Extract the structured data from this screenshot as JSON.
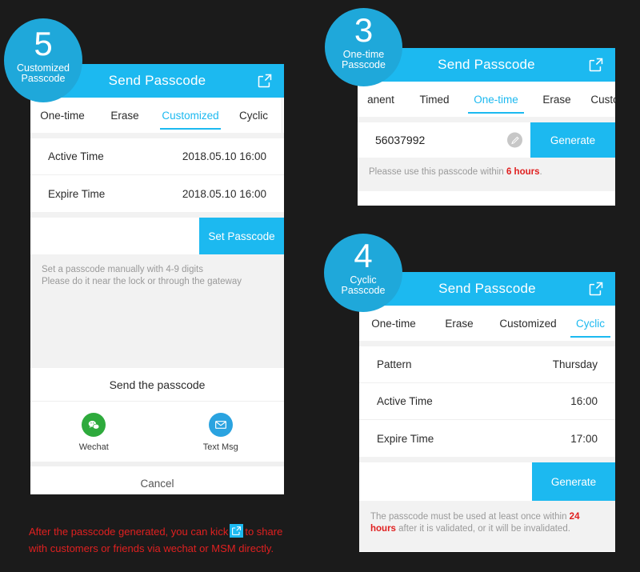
{
  "theme": {
    "background": "#1b1b1b",
    "accent": "#1cb9f0",
    "badge": "#1fa8da",
    "alert_red": "#e02020",
    "wechat_green": "#2eaa3c",
    "sms_blue": "#2aa3e0"
  },
  "panel_customized": {
    "badge": {
      "number": "5",
      "line1": "Customized",
      "line2": "Passcode"
    },
    "header": {
      "title": "Send Passcode",
      "share_icon": "share-external-icon"
    },
    "tabs": [
      {
        "label": "One-time",
        "active": false
      },
      {
        "label": "Erase",
        "active": false
      },
      {
        "label": "Customized",
        "active": true
      },
      {
        "label": "Cyclic",
        "active": false
      }
    ],
    "rows": [
      {
        "label": "Active Time",
        "value": "2018.05.10 16:00"
      },
      {
        "label": "Expire Time",
        "value": "2018.05.10 16:00"
      }
    ],
    "action_button": "Set Passcode",
    "hint_line1": "Set a passcode manually with 4-9 digits",
    "hint_line2": "Please do it near the lock or through the gateway",
    "share_sheet": {
      "title": "Send the passcode",
      "targets": [
        {
          "name": "Wechat",
          "icon": "wechat-icon"
        },
        {
          "name": "Text Msg",
          "icon": "envelope-icon"
        }
      ],
      "cancel": "Cancel"
    }
  },
  "panel_onetime": {
    "badge": {
      "number": "3",
      "line1": "One-time",
      "line2": "Passcode"
    },
    "header": {
      "title": "Send Passcode",
      "share_icon": "share-external-icon"
    },
    "tabs": [
      {
        "label": "anent",
        "active": false
      },
      {
        "label": "Timed",
        "active": false
      },
      {
        "label": "One-time",
        "active": true
      },
      {
        "label": "Erase",
        "active": false
      },
      {
        "label": "Custo",
        "active": false
      }
    ],
    "passcode_value": "56037992",
    "edit_icon": "pencil-edit-icon",
    "action_button": "Generate",
    "hint_prefix": "Pleasse use this passcode within ",
    "hint_highlight": "6 hours",
    "hint_suffix": "."
  },
  "panel_cyclic": {
    "badge": {
      "number": "4",
      "line1": "Cyclic",
      "line2": "Passcode"
    },
    "header": {
      "title": "Send Passcode",
      "share_icon": "share-external-icon"
    },
    "tabs": [
      {
        "label": "One-time",
        "active": false
      },
      {
        "label": "Erase",
        "active": false
      },
      {
        "label": "Customized",
        "active": false
      },
      {
        "label": "Cyclic",
        "active": true
      }
    ],
    "rows": [
      {
        "label": "Pattern",
        "value": "Thursday"
      },
      {
        "label": "Active Time",
        "value": "16:00"
      },
      {
        "label": "Expire Time",
        "value": "17:00"
      }
    ],
    "action_button": "Generate",
    "hint_prefix": "The passcode must be used at least once within ",
    "hint_highlight": "24 hours",
    "hint_suffix": " after it is validated, or it will be invalidated."
  },
  "caption": {
    "part1": "After the passcode generated, you can kick",
    "icon": "share-external-icon",
    "part2": "to share",
    "line2": "with customers or friends via wechat or MSM directly."
  }
}
